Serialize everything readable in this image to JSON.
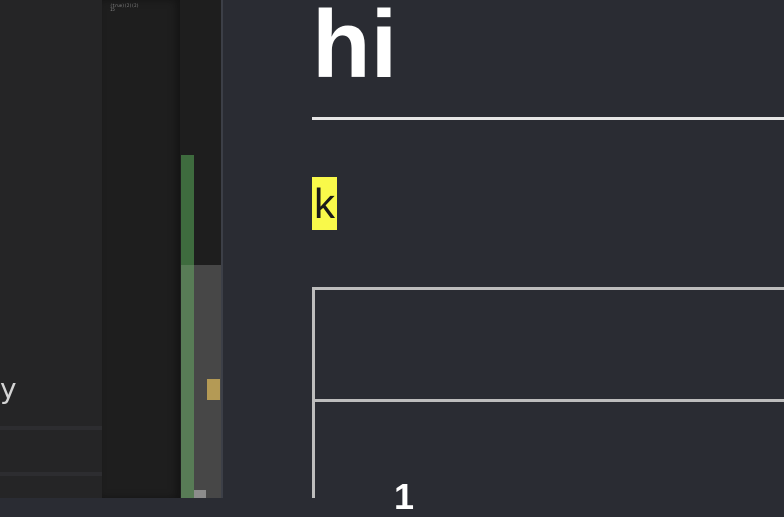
{
  "editor": {
    "glyph": "y"
  },
  "minimap": {
    "text": "\n(true)(2)(2)\n15"
  },
  "preview": {
    "title": "hi",
    "highlighted_text": "k",
    "table_cell": "1"
  },
  "colors": {
    "highlight": "#f9f94a",
    "diff_added": "#3e6b3e",
    "overview_marker": "#b49a55"
  }
}
